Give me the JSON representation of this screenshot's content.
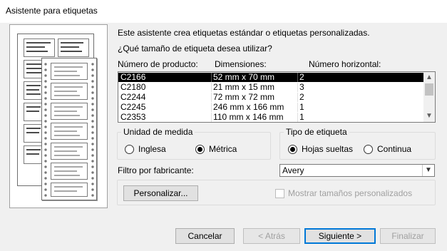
{
  "window": {
    "title": "Asistente para etiquetas"
  },
  "intro": {
    "line1": "Este asistente crea etiquetas estándar o etiquetas personalizadas.",
    "line2": "¿Qué tamaño de etiqueta desea utilizar?"
  },
  "table": {
    "headers": [
      "Número de producto:",
      "Dimensiones:",
      "Número horizontal:"
    ],
    "rows": [
      {
        "product": "C2166",
        "dimensions": "52 mm x 70 mm",
        "horizontal": "2",
        "selected": true
      },
      {
        "product": "C2180",
        "dimensions": "21 mm x 15 mm",
        "horizontal": "3",
        "selected": false
      },
      {
        "product": "C2244",
        "dimensions": "72 mm x 72 mm",
        "horizontal": "2",
        "selected": false
      },
      {
        "product": "C2245",
        "dimensions": "246 mm x 166 mm",
        "horizontal": "1",
        "selected": false
      },
      {
        "product": "C2353",
        "dimensions": "110 mm x 146 mm",
        "horizontal": "1",
        "selected": false
      }
    ]
  },
  "units": {
    "legend": "Unidad de medida",
    "options": [
      {
        "label": "Inglesa",
        "checked": false
      },
      {
        "label": "Métrica",
        "checked": true
      }
    ]
  },
  "label_type": {
    "legend": "Tipo de etiqueta",
    "options": [
      {
        "label": "Hojas sueltas",
        "checked": true
      },
      {
        "label": "Continua",
        "checked": false
      }
    ]
  },
  "filter": {
    "label": "Filtro por fabricante:",
    "value": "Avery"
  },
  "customize_button": "Personalizar...",
  "show_custom": {
    "label": "Mostrar tamaños personalizados",
    "checked": false,
    "enabled": false
  },
  "footer": {
    "cancel": "Cancelar",
    "back": "< Atrás",
    "next": "Siguiente >",
    "finish": "Finalizar"
  },
  "icons": {
    "scroll_up": "chevron-up-icon",
    "scroll_down": "chevron-down-icon",
    "combo": "chevron-down-icon",
    "illustration": "label-sheets-icon"
  },
  "colors": {
    "selection": "#000000",
    "default_button_border": "#0078d7",
    "dialog_bg": "#f0f0f0"
  }
}
